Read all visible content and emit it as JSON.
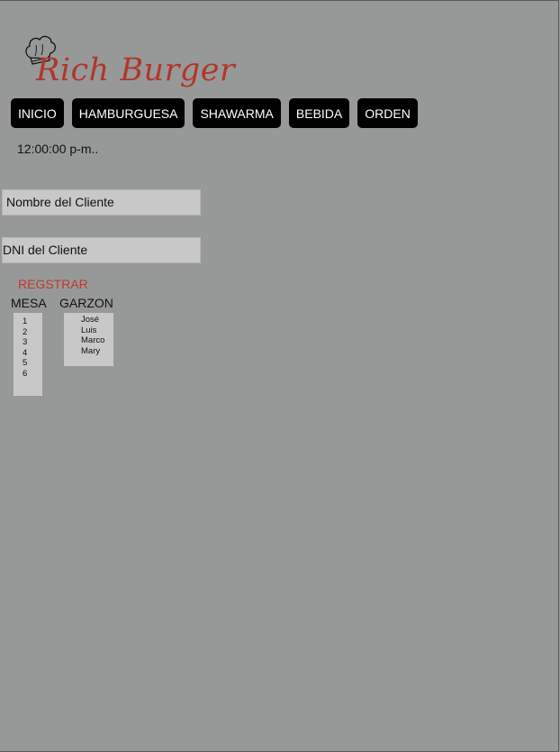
{
  "header": {
    "brand": "Rich Burger",
    "logo_icon": "chef-hat-icon",
    "brand_color": "#b0362d"
  },
  "nav": {
    "items": [
      "INICIO",
      "HAMBURGUESA",
      "SHAWARMA",
      "BEBIDA",
      "ORDEN"
    ]
  },
  "clock": {
    "text": "12:00:00 p-m.."
  },
  "form": {
    "client_name": {
      "placeholder": "Nombre  del Cliente"
    },
    "client_dni": {
      "placeholder": "DNI  del Cliente"
    },
    "register_label": "REGSTRAR",
    "mesa": {
      "label": "MESA",
      "options": [
        "1",
        "2",
        "3",
        "4",
        "5",
        "6"
      ]
    },
    "garzon": {
      "label": "GARZON",
      "options": [
        "José",
        "Luis",
        "Marco",
        "Mary"
      ]
    }
  }
}
